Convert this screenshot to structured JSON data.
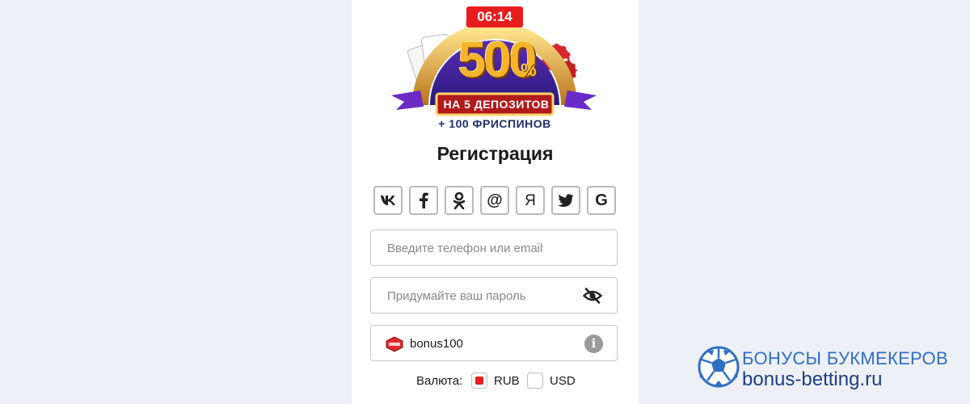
{
  "timer": "06:14",
  "banner": {
    "amount": "500",
    "percent": "%",
    "ribbon": "НА 5 ДЕПОЗИТОВ",
    "subtitle": "+ 100 ФРИСПИНОВ"
  },
  "form": {
    "title": "Регистрация",
    "socials": [
      {
        "icon": "vk-icon",
        "glyph": "vk"
      },
      {
        "icon": "facebook-icon",
        "glyph": "f"
      },
      {
        "icon": "odnoklassniki-icon",
        "glyph": "ok"
      },
      {
        "icon": "mail-icon",
        "glyph": "@"
      },
      {
        "icon": "yandex-icon",
        "glyph": "Я"
      },
      {
        "icon": "twitter-icon",
        "glyph": "bird"
      },
      {
        "icon": "google-icon",
        "glyph": "G"
      }
    ],
    "phone_placeholder": "Введите телефон или email",
    "password_placeholder": "Придумайте ваш пароль",
    "promo_value": "bonus100",
    "currency_label": "Валюта:",
    "currency_options": [
      {
        "label": "RUB",
        "checked": true
      },
      {
        "label": "USD",
        "checked": false
      }
    ]
  },
  "watermark": {
    "line1": "БОНУСЫ БУКМЕКЕРОВ",
    "line2": "bonus-betting.ru"
  },
  "colors": {
    "background": "#eef0f7",
    "accent_red": "#e81c1c",
    "watermark_blue": "#2f6fc4"
  }
}
